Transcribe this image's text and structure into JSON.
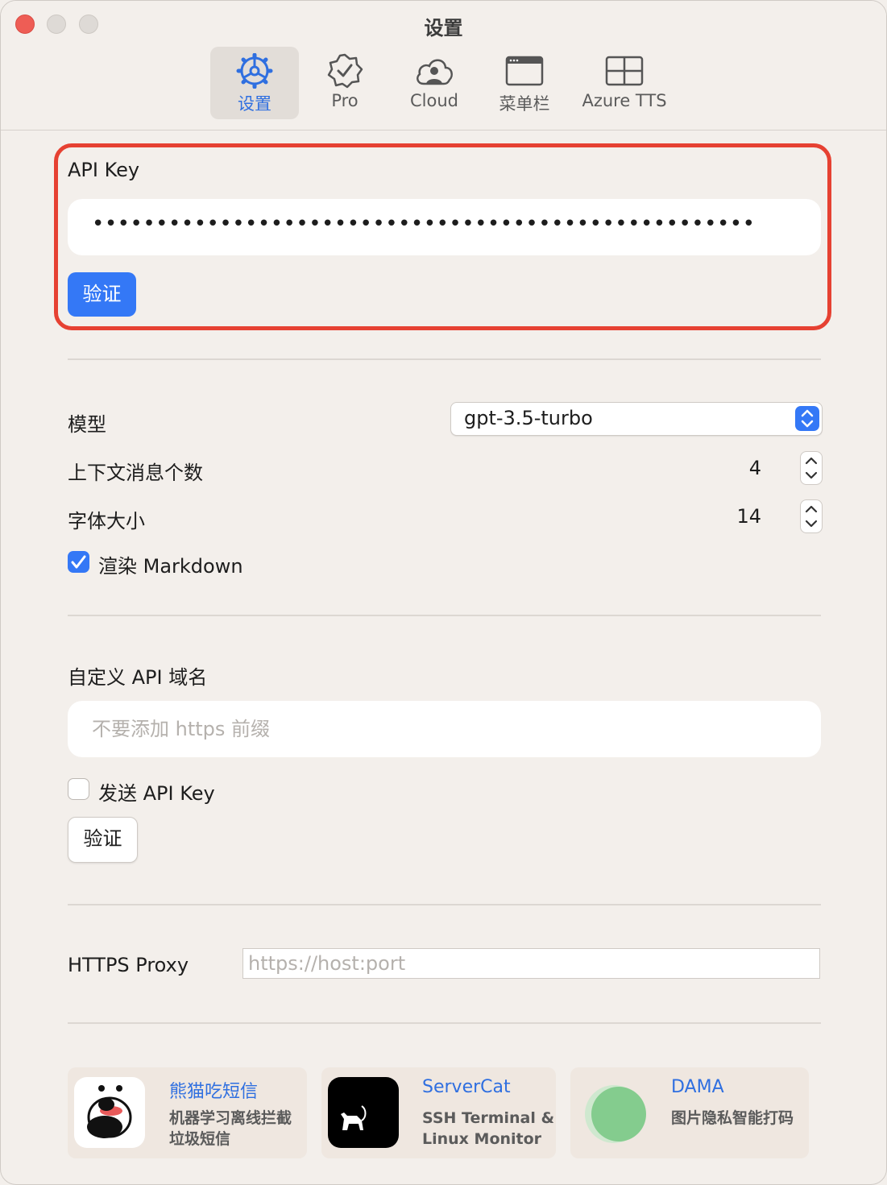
{
  "window": {
    "title": "设置"
  },
  "toolbar": {
    "tabs": [
      {
        "label": "设置",
        "icon": "gear-icon"
      },
      {
        "label": "Pro",
        "icon": "verified-badge-icon"
      },
      {
        "label": "Cloud",
        "icon": "cloud-person-icon"
      },
      {
        "label": "菜单栏",
        "icon": "menubar-window-icon"
      },
      {
        "label": "Azure TTS",
        "icon": "grid-icon"
      }
    ]
  },
  "api_key": {
    "label": "API Key",
    "masked_value": "••••••••••••••••••••••••••••••••••••••••••••••••••••",
    "verify_label": "验证"
  },
  "settings": {
    "model_label": "模型",
    "model_value": "gpt-3.5-turbo",
    "context_label": "上下文消息个数",
    "context_value": "4",
    "font_label": "字体大小",
    "font_value": "14",
    "markdown_label": "渲染 Markdown",
    "markdown_checked": true
  },
  "custom_domain": {
    "label": "自定义 API 域名",
    "placeholder": "不要添加 https 前缀",
    "send_key_label": "发送 API Key",
    "send_key_checked": false,
    "verify_label": "验证"
  },
  "proxy": {
    "label": "HTTPS Proxy",
    "placeholder": "https://host:port"
  },
  "promos": [
    {
      "title": "熊猫吃短信",
      "desc_line1": "机器学习离线拦截",
      "desc_line2": "垃圾短信",
      "icon": "panda-app-icon"
    },
    {
      "title": "ServerCat",
      "desc_line1": "SSH Terminal &",
      "desc_line2": "Linux Monitor",
      "icon": "cat-app-icon"
    },
    {
      "title": "DAMA",
      "desc_line1": "图片隐私智能打码",
      "desc_line2": "",
      "icon": "green-circle-app-icon"
    }
  ],
  "colors": {
    "accent": "#3478f6",
    "highlight": "#e64132",
    "background": "#f3efeb"
  }
}
